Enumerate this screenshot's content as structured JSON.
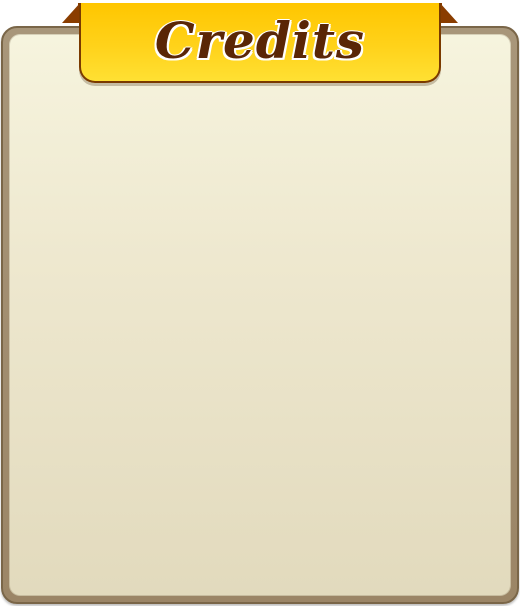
{
  "panel": {
    "title": "Credits"
  },
  "colors": {
    "banner_yellow": "#ffd21a",
    "banner_border": "#7a3a00",
    "title_brown": "#5a2606",
    "paper_cream": "#eee8cf",
    "frame_brown": "#9b8566"
  }
}
